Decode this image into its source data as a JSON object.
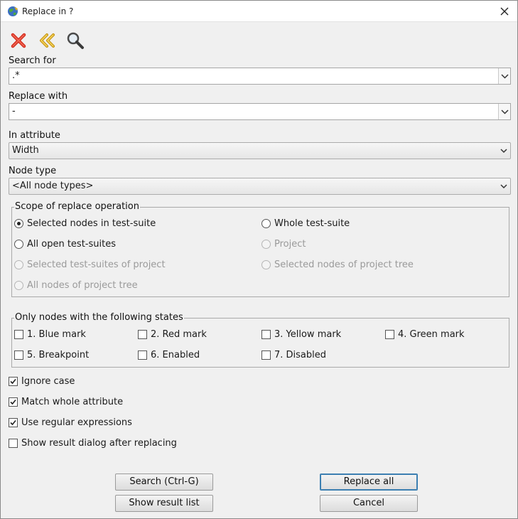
{
  "window": {
    "title": "Replace in ?"
  },
  "toolbar": {
    "icons": [
      "close-red-x-icon",
      "back-double-chevron-icon",
      "magnifier-icon"
    ]
  },
  "search": {
    "label": "Search for",
    "value": ".*"
  },
  "replace": {
    "label": "Replace with",
    "value": "-"
  },
  "attribute": {
    "label": "In attribute",
    "value": "Width"
  },
  "node_type": {
    "label": "Node type",
    "value": "<All node types>"
  },
  "scope": {
    "title": "Scope of replace operation",
    "options": [
      {
        "label": "Selected nodes in test-suite",
        "selected": true,
        "enabled": true
      },
      {
        "label": "Whole test-suite",
        "selected": false,
        "enabled": true
      },
      {
        "label": "All open test-suites",
        "selected": false,
        "enabled": true
      },
      {
        "label": "Project",
        "selected": false,
        "enabled": false
      },
      {
        "label": "Selected test-suites of project",
        "selected": false,
        "enabled": false
      },
      {
        "label": "Selected nodes of project tree",
        "selected": false,
        "enabled": false
      },
      {
        "label": "All nodes of project tree",
        "selected": false,
        "enabled": false
      }
    ]
  },
  "states": {
    "title": "Only nodes with the following states",
    "items": [
      {
        "label": "1. Blue mark",
        "checked": false
      },
      {
        "label": "2. Red mark",
        "checked": false
      },
      {
        "label": "3. Yellow mark",
        "checked": false
      },
      {
        "label": "4. Green mark",
        "checked": false
      },
      {
        "label": "5. Breakpoint",
        "checked": false
      },
      {
        "label": "6. Enabled",
        "checked": false
      },
      {
        "label": "7. Disabled",
        "checked": false
      }
    ]
  },
  "options": [
    {
      "label": "Ignore case",
      "checked": true
    },
    {
      "label": "Match whole attribute",
      "checked": true
    },
    {
      "label": "Use regular expressions",
      "checked": true
    },
    {
      "label": "Show result dialog after replacing",
      "checked": false
    }
  ],
  "buttons": {
    "search": "Search (Ctrl-G)",
    "replace_all": "Replace all",
    "show_result": "Show result list",
    "cancel": "Cancel"
  }
}
